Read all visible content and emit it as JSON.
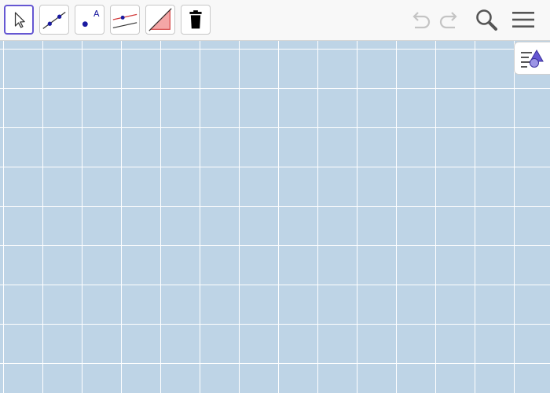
{
  "toolbar": {
    "tools": [
      {
        "id": "move",
        "icon": "arrow-pointer-icon",
        "selected": true
      },
      {
        "id": "line",
        "icon": "line-through-two-points-icon",
        "selected": false
      },
      {
        "id": "point",
        "icon": "point-icon",
        "label": "A",
        "selected": false
      },
      {
        "id": "parallel-line",
        "icon": "parallel-line-icon",
        "selected": false
      },
      {
        "id": "polygon",
        "icon": "polygon-triangle-icon",
        "selected": false
      },
      {
        "id": "delete",
        "icon": "trash-icon",
        "selected": false
      }
    ],
    "right_buttons": [
      {
        "id": "undo",
        "icon": "undo-icon",
        "enabled": false
      },
      {
        "id": "redo",
        "icon": "redo-icon",
        "enabled": false
      },
      {
        "id": "search",
        "icon": "search-icon"
      },
      {
        "id": "menu",
        "icon": "hamburger-menu-icon"
      }
    ]
  },
  "colors": {
    "accent": "#6557d2",
    "grid_background": "#bed4e6",
    "grid_lines": "#ffffff",
    "toolbar_background": "#f8f8f8",
    "point_blue": "#1a1aa0",
    "polygon_fill": "#f4a6a6",
    "polygon_stroke": "#d23c3c"
  },
  "graphics_view": {
    "grid": true,
    "style_bar_toggle": {
      "icon": "style-bar-toggle-icon"
    }
  }
}
